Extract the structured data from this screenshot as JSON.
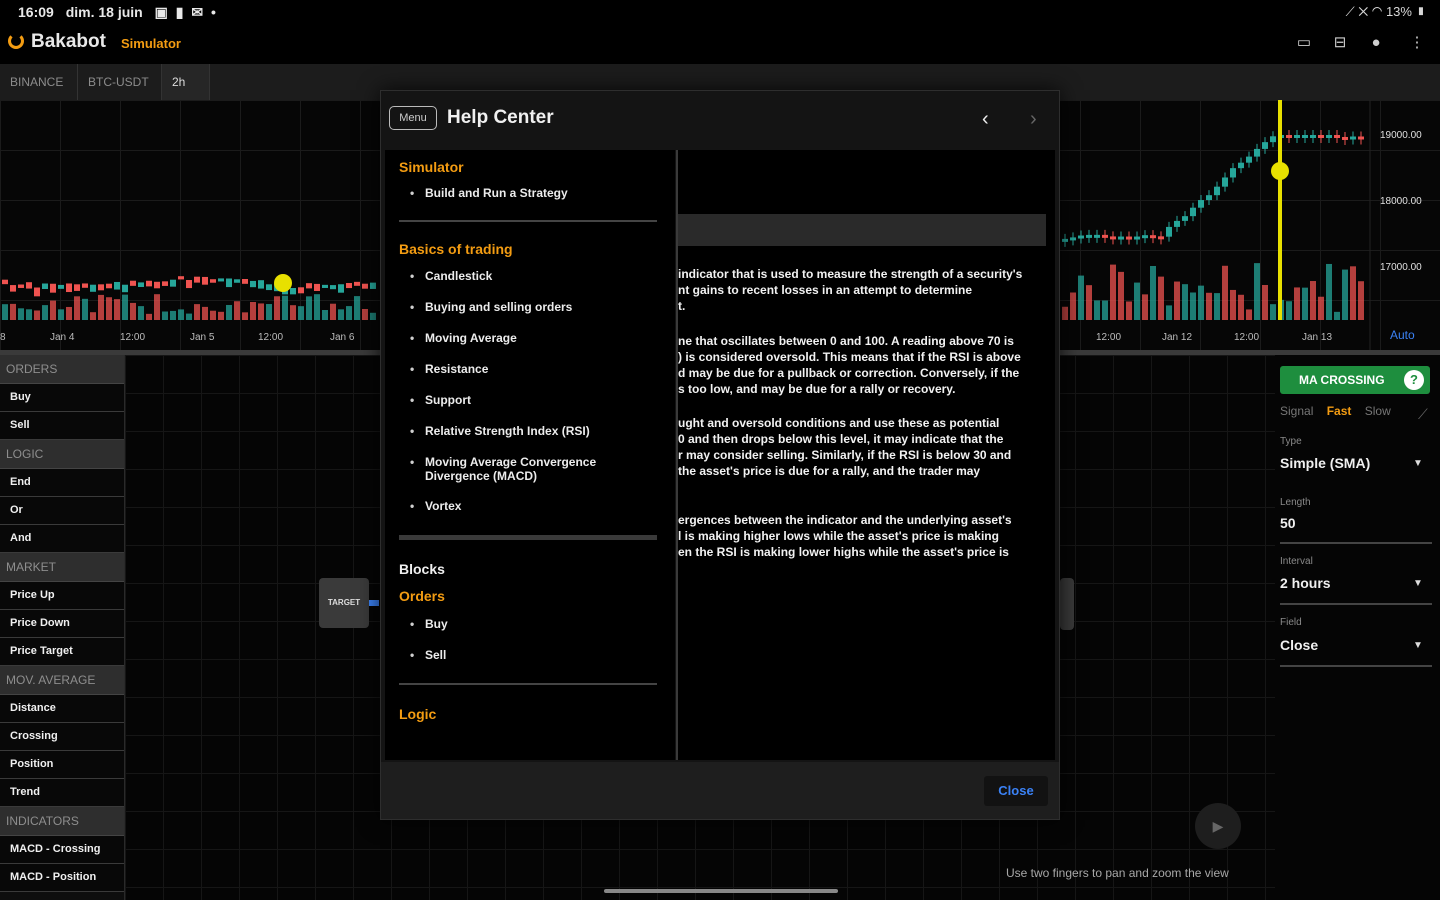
{
  "status_bar": {
    "time": "16:09",
    "date": "dim. 18 juin",
    "battery": "13%"
  },
  "app": {
    "name": "Bakabot",
    "mode": "Simulator"
  },
  "toolbar": {
    "tabs": [
      "BINANCE",
      "BTC-USDT",
      "2h"
    ]
  },
  "chart": {
    "x_ticks_left": [
      "Jan 4",
      "12:00",
      "Jan 5",
      "12:00",
      "Jan 6"
    ],
    "x_ticks_right": [
      "12:00",
      "Jan 12",
      "12:00",
      "Jan 13"
    ],
    "y_ticks": [
      "19000.00",
      "18000.00",
      "17000.00"
    ],
    "auto_label": "Auto",
    "colors": {
      "up": "#26a69a",
      "down": "#ef5350",
      "marker": "#e8e000"
    }
  },
  "palette": {
    "sections": [
      {
        "title": "ORDERS",
        "items": [
          "Buy",
          "Sell"
        ]
      },
      {
        "title": "LOGIC",
        "items": [
          "End",
          "Or",
          "And"
        ]
      },
      {
        "title": "MARKET",
        "items": [
          "Price Up",
          "Price Down",
          "Price Target"
        ]
      },
      {
        "title": "MOV. AVERAGE",
        "items": [
          "Distance",
          "Crossing",
          "Position",
          "Trend"
        ]
      },
      {
        "title": "INDICATORS",
        "items": [
          "MACD - Crossing",
          "MACD - Position"
        ]
      }
    ]
  },
  "workspace": {
    "target_node": "TARGET",
    "hint": "Use two fingers to pan and zoom the view"
  },
  "properties": {
    "block_name": "MA CROSSING",
    "help_icon": "?",
    "signal_tabs": [
      "Signal",
      "Fast",
      "Slow"
    ],
    "type_label": "Type",
    "type_value": "Simple (SMA)",
    "length_label": "Length",
    "length_value": "50",
    "interval_label": "Interval",
    "interval_value": "2 hours",
    "field_label": "Field",
    "field_value": "Close"
  },
  "help_center": {
    "menu_label": "Menu",
    "title": "Help Center",
    "close_label": "Close",
    "nav": {
      "simulator": {
        "title": "Simulator",
        "items": [
          "Build and Run a Strategy"
        ]
      },
      "basics": {
        "title": "Basics of trading",
        "items": [
          "Candlestick",
          "Buying and selling orders",
          "Moving Average",
          "Resistance",
          "Support",
          "Relative Strength Index (RSI)",
          "Moving Average Convergence Divergence (MACD)",
          "Vortex"
        ]
      },
      "blocks": "Blocks",
      "orders": {
        "title": "Orders",
        "items": [
          "Buy",
          "Sell"
        ]
      },
      "logic": "Logic"
    },
    "content": {
      "p1": "indicator that is used to measure the strength of a security's\nnt gains to recent losses in an attempt to determine\nt.",
      "p2": "ne that oscillates between 0 and 100. A reading above 70 is\n) is considered oversold. This means that if the RSI is above\nd may be due for a pullback or correction. Conversely, if the\ns too low, and may be due for a rally or recovery.",
      "p3": "ught and oversold conditions and use these as potential\n0 and then drops below this level, it may indicate that the\nr may consider selling. Similarly, if the RSI is below 30 and\nthe asset's price is due for a rally, and the trader may",
      "p4": "ergences between the indicator and the underlying asset's\nl is making higher lows while the asset's price is making\nen the RSI is making lower highs while the asset's price is"
    }
  }
}
